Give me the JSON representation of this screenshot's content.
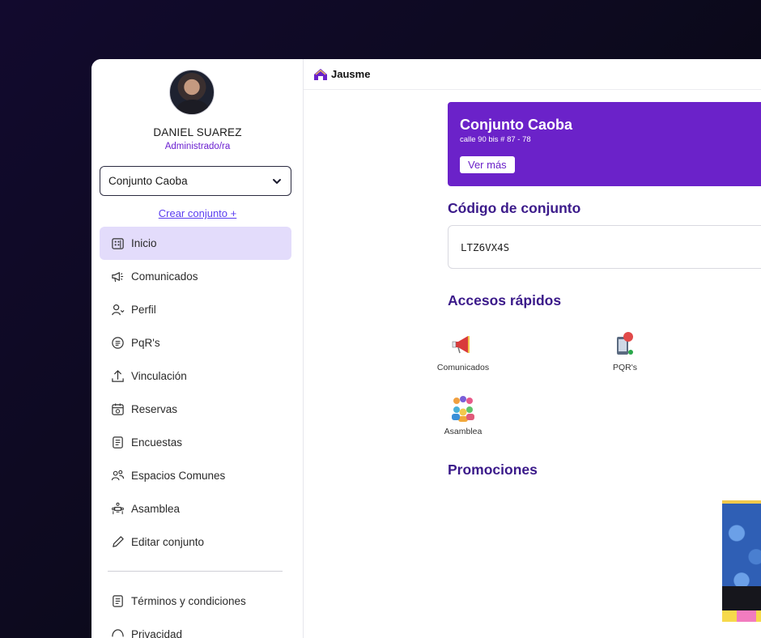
{
  "user": {
    "name": "DANIEL SUAREZ",
    "role": "Administrado/ra"
  },
  "selector": {
    "value": "Conjunto Caoba"
  },
  "create_link": "Crear conjunto +",
  "nav": [
    {
      "label": "Inicio",
      "icon": "building-icon",
      "active": true
    },
    {
      "label": "Comunicados",
      "icon": "megaphone-icon"
    },
    {
      "label": "Perfil",
      "icon": "user-icon"
    },
    {
      "label": "PqR's",
      "icon": "message-circle-icon"
    },
    {
      "label": "Vinculación",
      "icon": "upload-icon"
    },
    {
      "label": "Reservas",
      "icon": "calendar-icon"
    },
    {
      "label": "Encuestas",
      "icon": "document-icon"
    },
    {
      "label": "Espacios Comunes",
      "icon": "users-icon"
    },
    {
      "label": "Asamblea",
      "icon": "meeting-icon"
    },
    {
      "label": "Editar conjunto",
      "icon": "pencil-icon"
    }
  ],
  "nav_footer": [
    {
      "label": "Términos y condiciones",
      "icon": "document-icon"
    },
    {
      "label": "Privacidad",
      "icon": "shield-icon"
    }
  ],
  "brand": {
    "name": "Jausme",
    "color": "#6b22c9"
  },
  "banner": {
    "title": "Conjunto Caoba",
    "address": "calle 90 bis # 87 - 78",
    "button": "Ver más"
  },
  "code_section": {
    "title": "Código de conjunto",
    "code": "LTZ6VX4S"
  },
  "quick_access": {
    "title": "Accesos rápidos",
    "items": [
      {
        "label": "Comunicados",
        "icon": "megaphone-icon"
      },
      {
        "label": "PQR's",
        "icon": "phone-chat-icon"
      },
      {
        "label": "Asamblea",
        "icon": "people-group-icon"
      }
    ]
  },
  "promotions": {
    "title": "Promociones"
  },
  "colors": {
    "accent": "#6b22c9",
    "heading": "#3b1a8a",
    "active_nav": "#e3dcfb"
  }
}
